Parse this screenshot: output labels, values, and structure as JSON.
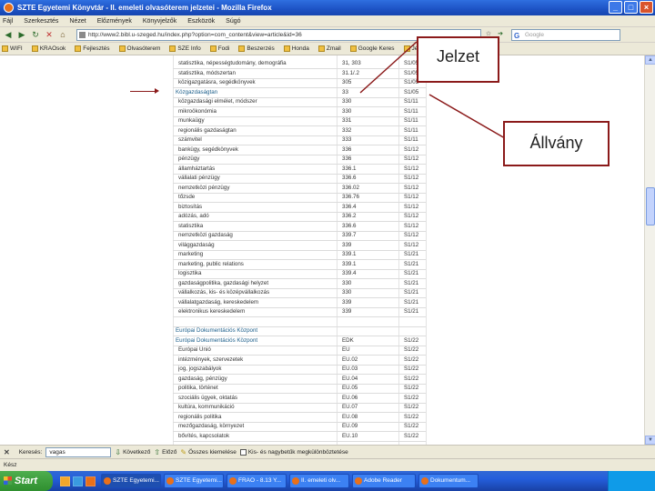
{
  "window": {
    "title": "SZTE Egyetemi Könyvtár - II. emeleti olvasóterem jelzetei - Mozilla Firefox"
  },
  "menu": {
    "items": [
      "Fájl",
      "Szerkesztés",
      "Nézet",
      "Előzmények",
      "Könyvjelzők",
      "Eszközök",
      "Súgó"
    ]
  },
  "nav": {
    "url": "http://www2.bibl.u-szeged.hu/index.php?option=com_content&view=article&id=36",
    "search_placeholder": "Google"
  },
  "bookmarks": {
    "items": [
      "WIFI",
      "KRAOsok",
      "Fejlesztés",
      "Olvasóterem",
      "SZE Info",
      "Fodi",
      "Beszerzés",
      "Honda",
      "Zmail",
      "Google Keres",
      "Jelzet"
    ]
  },
  "table": {
    "rows": [
      {
        "label": "statisztika, népességtudomány, demográfia",
        "code": "31, 303",
        "loc": "S1/05"
      },
      {
        "label": "statisztika, módszertan",
        "code": "31.1/.2",
        "loc": "S1/05"
      },
      {
        "label": "közigazgatásra, segédkönyvek",
        "code": "305",
        "loc": "S1/05"
      },
      {
        "label": "Közgazdaságtan",
        "code": "33",
        "loc": "S1/05",
        "head": true
      },
      {
        "label": "közgazdasági elmélet, módszer",
        "code": "330",
        "loc": "S1/11"
      },
      {
        "label": "mikroökonómia",
        "code": "330",
        "loc": "S1/11"
      },
      {
        "label": "munkaügy",
        "code": "331",
        "loc": "S1/11"
      },
      {
        "label": "regionális gazdaságtan",
        "code": "332",
        "loc": "S1/11"
      },
      {
        "label": "számvitel",
        "code": "333",
        "loc": "S1/11"
      },
      {
        "label": "bankügy, segédkönyvek",
        "code": "336",
        "loc": "S1/12"
      },
      {
        "label": "pénzügy",
        "code": "336",
        "loc": "S1/12"
      },
      {
        "label": "államháztartás",
        "code": "336.1",
        "loc": "S1/12"
      },
      {
        "label": "vállalati pénzügy",
        "code": "336.6",
        "loc": "S1/12"
      },
      {
        "label": "nemzetközi pénzügy",
        "code": "336.02",
        "loc": "S1/12"
      },
      {
        "label": "tőzsde",
        "code": "336.76",
        "loc": "S1/12"
      },
      {
        "label": "biztosítás",
        "code": "336.4",
        "loc": "S1/12"
      },
      {
        "label": "adózás, adó",
        "code": "336.2",
        "loc": "S1/12"
      },
      {
        "label": "statisztika",
        "code": "336.6",
        "loc": "S1/12"
      },
      {
        "label": "nemzetközi gazdaság",
        "code": "339.7",
        "loc": "S1/12"
      },
      {
        "label": "világgazdaság",
        "code": "339",
        "loc": "S1/12"
      },
      {
        "label": "marketing",
        "code": "339.1",
        "loc": "S1/21"
      },
      {
        "label": "marketing, public relations",
        "code": "339.1",
        "loc": "S1/21"
      },
      {
        "label": "logisztika",
        "code": "339.4",
        "loc": "S1/21"
      },
      {
        "label": "gazdaságpolitika, gazdasági helyzet",
        "code": "330",
        "loc": "S1/21"
      },
      {
        "label": "vállalkozás, kis- és középvállalkozás",
        "code": "330",
        "loc": "S1/21"
      },
      {
        "label": "vállalatgazdaság, kereskedelem",
        "code": "339",
        "loc": "S1/21"
      },
      {
        "label": "elektronikus kereskedelem",
        "code": "339",
        "loc": "S1/21"
      },
      {
        "label": "",
        "code": "",
        "loc": ""
      },
      {
        "label": "Európai Dokumentációs Központ",
        "code": "",
        "loc": "",
        "head": true
      },
      {
        "label": "Európai Dokumentációs Központ",
        "code": "EDK",
        "loc": "S1/22",
        "head": true
      },
      {
        "label": "Európai Unió",
        "code": "EU",
        "loc": "S1/22"
      },
      {
        "label": "intézmények, szervezetek",
        "code": "EU.02",
        "loc": "S1/22"
      },
      {
        "label": "jog, jogszabályok",
        "code": "EU.03",
        "loc": "S1/22"
      },
      {
        "label": "gazdaság, pénzügy",
        "code": "EU.04",
        "loc": "S1/22"
      },
      {
        "label": "politika, történet",
        "code": "EU.05",
        "loc": "S1/22"
      },
      {
        "label": "szociális ügyek, oktatás",
        "code": "EU.06",
        "loc": "S1/22"
      },
      {
        "label": "kultúra, kommunikáció",
        "code": "EU.07",
        "loc": "S1/22"
      },
      {
        "label": "regionális politika",
        "code": "EU.08",
        "loc": "S1/22"
      },
      {
        "label": "mezőgazdaság, környezet",
        "code": "EU.09",
        "loc": "S1/22"
      },
      {
        "label": "bővítés, kapcsolatok",
        "code": "EU.10",
        "loc": "S1/22"
      }
    ]
  },
  "annotations": {
    "jelzet": "Jelzet",
    "allvany": "Állvány"
  },
  "findbar": {
    "close": "✕",
    "label": "Keresés:",
    "value": "vagas",
    "next": "Következő",
    "prev": "Előző",
    "highlight": "Összes kiemelése",
    "match_case": "Kis- és nagybetűk megkülönböztetése"
  },
  "status": {
    "text": "Kész"
  },
  "taskbar": {
    "start": "Start",
    "tasks": [
      "SZTE Egyetemi...",
      "SZTE Egyetemi...",
      "FRAO - 8.13 Y...",
      "II. emeleti olv...",
      "Adobe Reader",
      "Dokumentum..."
    ],
    "tray_time": " "
  }
}
